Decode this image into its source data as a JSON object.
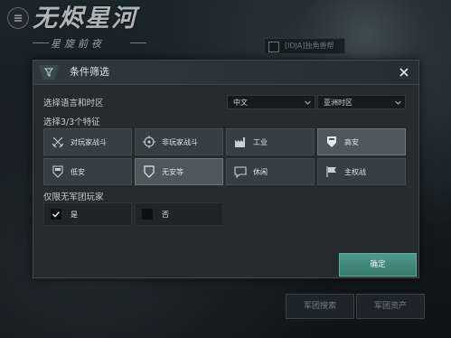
{
  "game": {
    "logo_title": "无烬星河",
    "logo_subtitle": "星旋前夜",
    "server_tag": "[IDJA]独角兽帮"
  },
  "background_buttons": [
    {
      "label": "军团搜索"
    },
    {
      "label": "军团资产"
    }
  ],
  "modal": {
    "title": "条件筛选",
    "language_label": "选择语言和时区",
    "language_value": "中文",
    "timezone_value": "亚洲时区",
    "traits_label": "选择3/3个特征",
    "traits": [
      {
        "label": "对玩家战斗",
        "icon": "crossed-swords-icon",
        "selected": false
      },
      {
        "label": "非玩家战斗",
        "icon": "target-icon",
        "selected": false
      },
      {
        "label": "工业",
        "icon": "factory-icon",
        "selected": false
      },
      {
        "label": "高安",
        "icon": "shield-high-icon",
        "selected": true
      },
      {
        "label": "低安",
        "icon": "shield-low-icon",
        "selected": false
      },
      {
        "label": "无安等",
        "icon": "shield-empty-icon",
        "selected": true
      },
      {
        "label": "休闲",
        "icon": "chat-bubble-icon",
        "selected": false
      },
      {
        "label": "主权战",
        "icon": "flag-icon",
        "selected": false
      }
    ],
    "pilot_only_label": "仅限无军团玩家",
    "yes_label": "是",
    "no_label": "否",
    "confirm_label": "确定"
  },
  "colors": {
    "accent": "#4f9a8c",
    "panel": "#262c2e",
    "tile": "#363f41",
    "tile_selected": "#4d585a"
  }
}
